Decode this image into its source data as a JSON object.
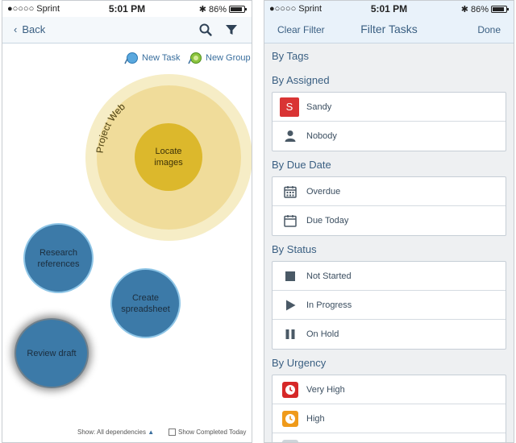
{
  "status_left": {
    "carrier": "●○○○○ Sprint",
    "time": "5:01 PM",
    "battery": "86%"
  },
  "status_right": {
    "carrier": "●○○○○ Sprint",
    "time": "5:01 PM",
    "battery": "86%"
  },
  "battery_level": 0.86,
  "left_nav": {
    "back_label": "Back"
  },
  "map_toolbar": {
    "new_task": "New Task",
    "new_group": "New Group"
  },
  "project": {
    "name": "Project Web",
    "center_task": "Locate images"
  },
  "tasks": [
    {
      "label": "Research references"
    },
    {
      "label": "Create spreadsheet"
    },
    {
      "label": "Review draft"
    }
  ],
  "map_footer": {
    "dependencies": "Show: All dependencies",
    "completed": "Show Completed Today"
  },
  "filter": {
    "clear": "Clear Filter",
    "title": "Filter Tasks",
    "done": "Done",
    "tags_heading": "By Tags",
    "assigned_heading": "By Assigned",
    "assigned": [
      {
        "label": "Sandy",
        "initial": "S"
      },
      {
        "label": "Nobody"
      }
    ],
    "due_heading": "By Due Date",
    "due": [
      {
        "label": "Overdue"
      },
      {
        "label": "Due Today"
      }
    ],
    "status_heading": "By Status",
    "status": [
      {
        "label": "Not Started"
      },
      {
        "label": "In Progress"
      },
      {
        "label": "On Hold"
      }
    ],
    "urgency_heading": "By Urgency",
    "urgency": [
      {
        "label": "Very High"
      },
      {
        "label": "High"
      }
    ]
  },
  "colors": {
    "accent": "#3a5f82",
    "task_blue": "#3c7aa8",
    "project_outer": "#f6edc6",
    "project_mid": "#f0dc9a",
    "project_core": "#dcb82c",
    "sandy_red": "#d93434",
    "very_high_red": "#d62828",
    "high_orange": "#ef9a1a"
  },
  "icons": [
    "chevron-left-icon",
    "search-icon",
    "filter-icon",
    "new-task-icon",
    "new-group-icon",
    "person-icon",
    "calendar-icon",
    "square-stop-icon",
    "play-icon",
    "pause-icon",
    "clock-icon"
  ]
}
